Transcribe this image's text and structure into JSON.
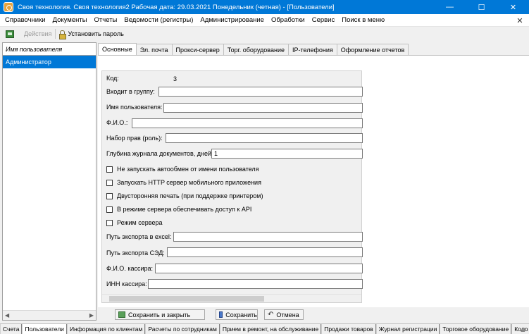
{
  "window": {
    "title": "Своя технология. Своя технология2  Рабочая дата: 29.03.2021  Понедельник (четная) - [Пользователи]",
    "minimize": "—",
    "maximize": "☐",
    "close": "✕"
  },
  "menu": {
    "items": [
      "Справочники",
      "Документы",
      "Отчеты",
      "Ведомости (регистры)",
      "Администрирование",
      "Обработки",
      "Сервис",
      "Поиск в меню"
    ],
    "close": "✕"
  },
  "toolbar": {
    "actions_label": "Действия",
    "set_password_label": "Установить пароль"
  },
  "users_list": {
    "header": "Имя пользователя",
    "rows": [
      "Администратор"
    ]
  },
  "tabs": [
    "Основные",
    "Эл. почта",
    "Прокси-сервер",
    "Торг. оборудование",
    "IP-телефония",
    "Оформление отчетов"
  ],
  "form": {
    "code_label": "Код:",
    "code_value": "3",
    "group_label": "Входит в группу:",
    "group_value": "",
    "username_label": "Имя пользователя:",
    "username_value": "",
    "fio_label": "Ф.И.О.:",
    "fio_value": "",
    "role_label": "Набор прав (роль):",
    "role_value": "",
    "journal_label": "Глубина журнала документов, дней:",
    "journal_value": "1",
    "checkboxes": [
      "Не запускать автообмен от имени пользователя",
      "Запускать HTTP сервер мобильного приложения",
      "Двусторонняя печать (при поддержке принтером)",
      "В режиме сервера обеспечивать доступ к API",
      "Режим сервера"
    ],
    "excel_label": "Путь экспорта в excel:",
    "excel_value": "",
    "sed_label": "Путь экспорта СЭД:",
    "sed_value": "",
    "cashier_fio_label": "Ф.И.О. кассира:",
    "cashier_fio_value": "",
    "cashier_inn_label": "ИНН кассира:",
    "cashier_inn_value": ""
  },
  "buttons": {
    "save_close": "Сохранить и закрыть",
    "save": "Сохранить",
    "cancel": "Отмена"
  },
  "bottom_tabs": [
    "Счета",
    "Пользователи",
    "Информация по клиентам",
    "Расчеты по сотрудникам",
    "Прием в ремонт, на обслуживание",
    "Продажи товаров",
    "Журнал регистрации",
    "Торговое оборудование",
    "Коло"
  ],
  "colors": {
    "titlebar": "#0078d7",
    "selection": "#0078d7"
  }
}
